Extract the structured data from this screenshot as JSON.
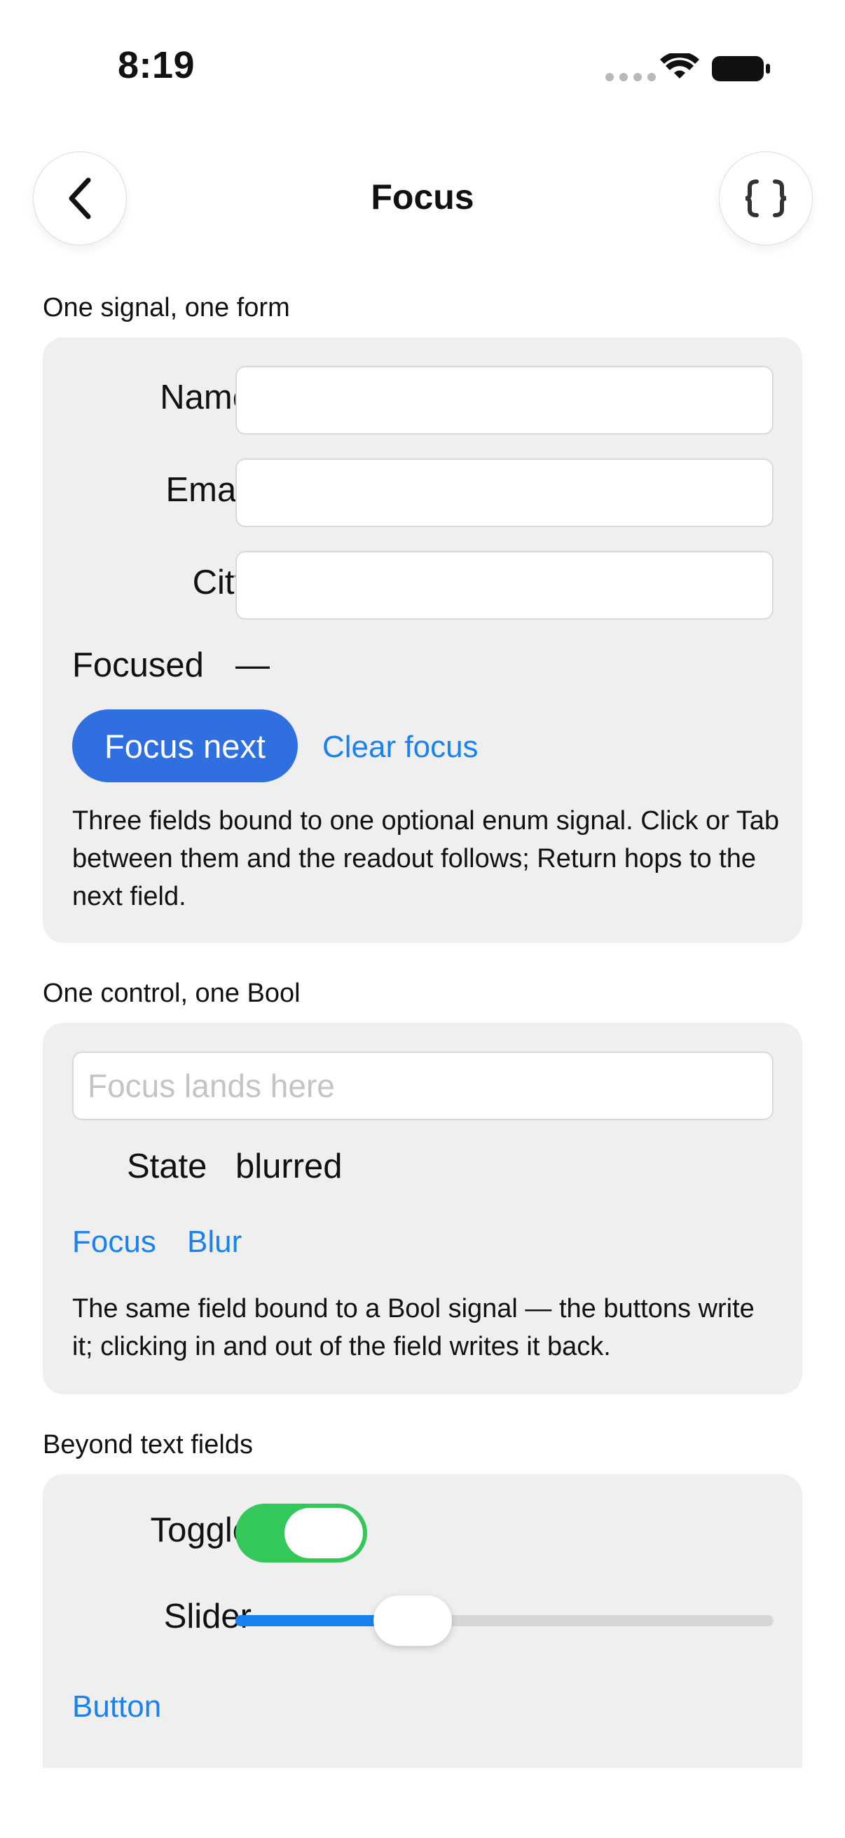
{
  "status_bar": {
    "time": "8:19"
  },
  "nav": {
    "title": "Focus",
    "back_icon": "chevron-left-icon",
    "code_icon": "braces-icon"
  },
  "section1": {
    "header": "One signal, one form",
    "fields": [
      {
        "label": "Name",
        "value": ""
      },
      {
        "label": "Email",
        "value": ""
      },
      {
        "label": "City",
        "value": ""
      }
    ],
    "focused_label": "Focused",
    "focused_value": "—",
    "focus_next_label": "Focus next",
    "clear_focus_label": "Clear focus",
    "description": "Three fields bound to one optional enum signal. Click or Tab between them and the readout follows; Return hops to the next field."
  },
  "section2": {
    "header": "One control, one Bool",
    "field_placeholder": "Focus lands here",
    "state_label": "State",
    "state_value": "blurred",
    "focus_label": "Focus",
    "blur_label": "Blur",
    "description": "The same field bound to a Bool signal — the buttons write it; clicking in and out of the field writes it back."
  },
  "section3": {
    "header": "Beyond text fields",
    "toggle_label": "Toggle",
    "toggle_on": true,
    "slider_label": "Slider",
    "slider_value": 0.33,
    "button_label": "Button"
  },
  "colors": {
    "accent": "#1a82f0",
    "primary_button": "#2f6fdf",
    "toggle_on": "#34c759",
    "card_bg": "#efefef"
  }
}
